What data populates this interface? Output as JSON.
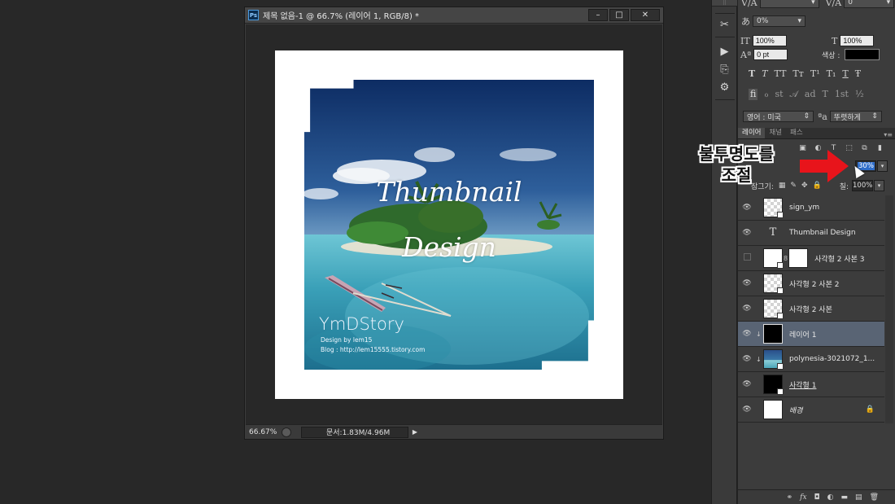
{
  "document": {
    "title": "제목 없음-1 @ 66.7% (레이어 1, RGB/8) *",
    "app_icon": "Ps",
    "zoom": "66.67%",
    "status": "문서:1.83M/4.96M",
    "thumbnail_line1": "Thumbnail",
    "thumbnail_line2": "Design",
    "brand": "YmDStory",
    "sign_line1": "Design by lem15",
    "sign_line2": "Blog : http://lem15555.tistory.com",
    "minimize_glyph": "–",
    "maximize_glyph": "□",
    "close_glyph": "✕"
  },
  "character": {
    "tracking": "0%",
    "vertical_scale": "100%",
    "horizontal_scale": "100%",
    "baseline_shift": "0 pt",
    "color_label": "색상 :",
    "color": "#000000",
    "kerning": "0",
    "language": "영어 : 미국",
    "aa_icon": "ªa",
    "antialias": "뚜렷하게",
    "typo_buttons": [
      "T",
      "T",
      "TT",
      "Tт",
      "T¹",
      "T₁",
      "T",
      "Ŧ"
    ],
    "opentype_buttons": [
      "fi",
      "ℴ",
      "st",
      "𝒜",
      "ad",
      "T",
      "1st",
      "½"
    ]
  },
  "layers_panel": {
    "tabs": [
      "레이어",
      "채널",
      "패스"
    ],
    "opacity": "30%",
    "lock_label": "잠그기:",
    "fill_label": "칠:",
    "fill_value": "100%",
    "layers": [
      {
        "name": "sign_ym",
        "thumb": "check",
        "visible": true,
        "smart": true
      },
      {
        "name": "Thumbnail Design",
        "thumb": "text",
        "visible": true
      },
      {
        "name": "사각형 2 사본 3",
        "thumb": "white-mask",
        "visible": false,
        "smart": true
      },
      {
        "name": "사각형 2 사본 2",
        "thumb": "check",
        "visible": true,
        "smart": true
      },
      {
        "name": "사각형 2 사본",
        "thumb": "check",
        "visible": true,
        "smart": true
      },
      {
        "name": "레이어 1",
        "thumb": "black",
        "visible": true,
        "active": true,
        "clipped": true
      },
      {
        "name": "polynesia-3021072_1...",
        "thumb": "photo",
        "visible": true,
        "clipped": true,
        "smart": true
      },
      {
        "name": "사각형 1",
        "thumb": "black",
        "visible": true,
        "underline": true,
        "smart": true
      },
      {
        "name": "배경",
        "thumb": "white",
        "visible": true,
        "italic": true,
        "locked": true
      }
    ]
  },
  "annotation": {
    "line1": "불투명도를",
    "line2": "조절",
    "arrow_color": "#e8141b"
  }
}
